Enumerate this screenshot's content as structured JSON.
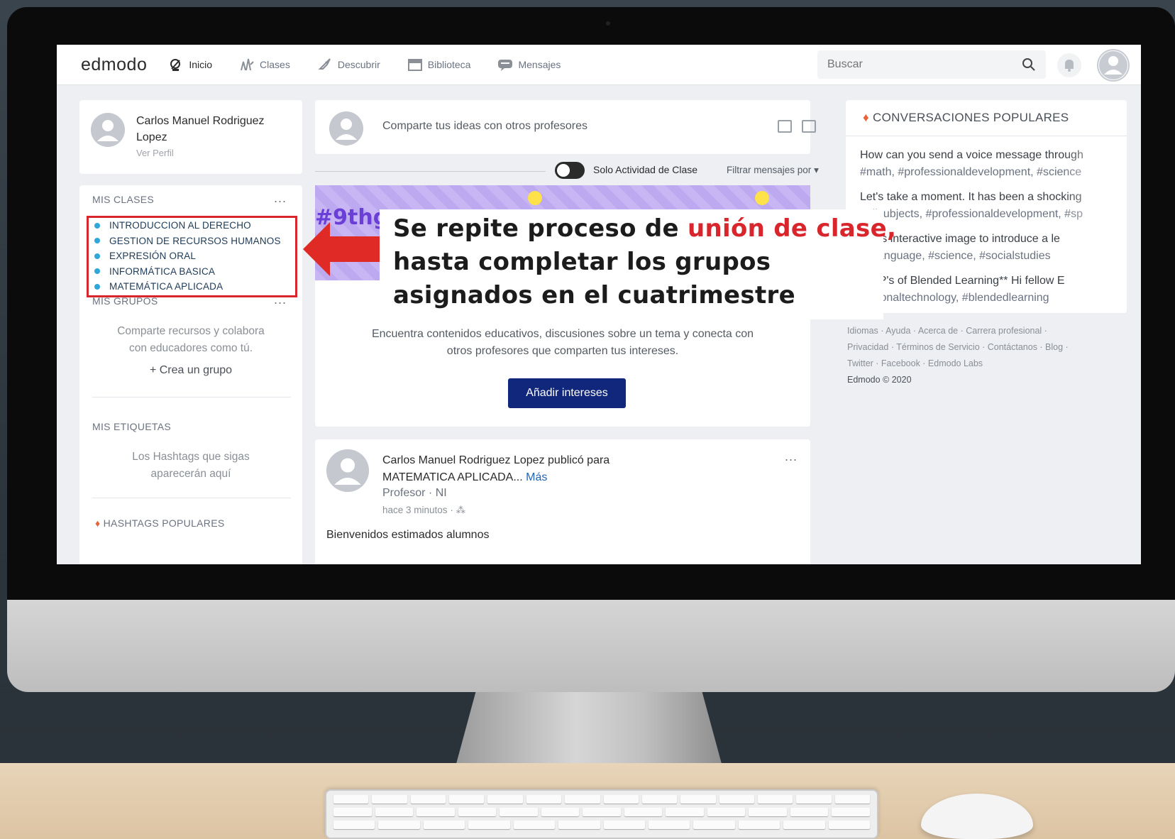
{
  "nav": {
    "logo": "edmodo",
    "items": [
      {
        "label": "Inicio",
        "icon": "home-icon",
        "active": true
      },
      {
        "label": "Clases",
        "icon": "classes-icon"
      },
      {
        "label": "Descubrir",
        "icon": "rocket-icon"
      },
      {
        "label": "Biblioteca",
        "icon": "library-icon"
      },
      {
        "label": "Mensajes",
        "icon": "message-icon"
      }
    ],
    "search_placeholder": "Buscar"
  },
  "profile": {
    "name": "Carlos Manuel Rodriguez Lopez",
    "link": "Ver Perfil"
  },
  "my_classes": {
    "heading": "MIS CLASES",
    "more": "...",
    "items": [
      "INTRODUCCION AL DERECHO",
      "GESTION DE RECURSOS HUMANOS",
      "EXPRESIÓN ORAL",
      "INFORMÁTICA BASICA",
      "MATEMÁTICA APLICADA"
    ]
  },
  "my_groups": {
    "heading": "MIS GRUPOS",
    "more": "...",
    "text": "Comparte recursos y colabora con educadores como tú.",
    "create": "Crea un grupo"
  },
  "my_tags": {
    "heading": "MIS ETIQUETAS",
    "text": "Los Hashtags que sigas aparecerán aquí"
  },
  "popular_hashtags": {
    "heading": "HASHTAGS POPULARES"
  },
  "compose": {
    "placeholder": "Comparte tus ideas con otros profesores"
  },
  "filter": {
    "toggle_label": "Solo Actividad de Clase",
    "filter_label": "Filtrar mensajes por"
  },
  "discover": {
    "banner_tag": "#9thg",
    "text": "Encuentra contenidos educativos, discusiones sobre un tema y conecta con otros profesores que comparten tus intereses.",
    "button": "Añadir intereses"
  },
  "post": {
    "author_line": "Carlos Manuel Rodriguez Lopez publicó para MATEMATICA APLICADA...",
    "more": "Más",
    "role": "Profesor · NI",
    "time": "hace 3 minutos",
    "menu": "...",
    "body": "Bienvenidos estimados alumnos"
  },
  "conversations": {
    "heading": "CONVERSACIONES POPULARES",
    "items": [
      {
        "title": "How can you send a voice message through",
        "tags": "#math, #professionaldevelopment, #science"
      },
      {
        "title": "Let's take a moment. It has been a shocking",
        "tags": "#allsubjects, #professionaldevelopment, #sp"
      },
      {
        "title": "d this interactive image to introduce a le",
        "tags": "ignlanguage, #science, #socialstudies"
      },
      {
        "title": "Six P's of Blended Learning** Hi fellow E",
        "tags": "icationaltechnology, #blendedlearning"
      }
    ]
  },
  "footer": {
    "line1": "Idiomas · Ayuda · Acerca de · Carrera profesional ·",
    "line2": "Privacidad · Términos de Servicio · Contáctanos · Blog ·",
    "line3": "Twitter · Facebook · Edmodo Labs",
    "copyright": "Edmodo © 2020"
  },
  "overlay": {
    "line1_a": "Se repite proceso de ",
    "line1_b": "unión de clase,",
    "line2": "hasta completar los grupos",
    "line3": "asignados en el cuatrimestre"
  },
  "colors": {
    "highlight_red": "#d8262c",
    "button_navy": "#11277c",
    "class_dot": "#2ea8d8"
  }
}
